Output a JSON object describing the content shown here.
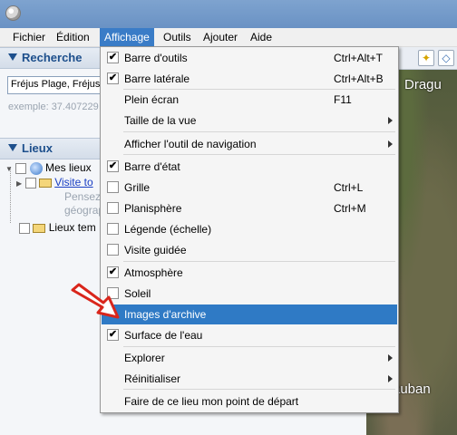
{
  "menubar": {
    "items": [
      {
        "label": "Fichier"
      },
      {
        "label": "Édition"
      },
      {
        "label": "Affichage"
      },
      {
        "label": "Outils"
      },
      {
        "label": "Ajouter"
      },
      {
        "label": "Aide"
      }
    ]
  },
  "search_panel": {
    "title": "Recherche",
    "input_value": "Fréjus Plage, Fréjus",
    "example": "exemple: 37.407229"
  },
  "places_panel": {
    "title": "Lieux",
    "items": [
      {
        "label": "Mes lieux"
      },
      {
        "label": "Visite to"
      },
      {
        "label": "Pensez"
      },
      {
        "label": "géograp"
      },
      {
        "label": "Lieux tem"
      }
    ]
  },
  "map": {
    "labels": [
      "Dragu",
      "auban"
    ]
  },
  "view_menu": {
    "items": [
      {
        "label": "Barre d'outils",
        "shortcut": "Ctrl+Alt+T",
        "checked": true
      },
      {
        "label": "Barre latérale",
        "shortcut": "Ctrl+Alt+B",
        "checked": true
      },
      {
        "label": "Plein écran",
        "shortcut": "F11"
      },
      {
        "label": "Taille de la vue",
        "submenu": true
      },
      {
        "label": "Afficher l'outil de navigation",
        "submenu": true
      },
      {
        "label": "Barre d'état",
        "checked": true
      },
      {
        "label": "Grille",
        "shortcut": "Ctrl+L",
        "checked": false
      },
      {
        "label": "Planisphère",
        "shortcut": "Ctrl+M",
        "checked": false
      },
      {
        "label": "Légende (échelle)",
        "checked": false
      },
      {
        "label": "Visite guidée",
        "checked": false
      },
      {
        "label": "Atmosphère",
        "checked": true
      },
      {
        "label": "Soleil",
        "checked": false
      },
      {
        "label": "Images d'archive",
        "checked": false,
        "highlighted": true
      },
      {
        "label": "Surface de l'eau",
        "checked": true
      },
      {
        "label": "Explorer",
        "submenu": true
      },
      {
        "label": "Réinitialiser",
        "submenu": true
      },
      {
        "label": "Faire de ce lieu mon point de départ"
      }
    ],
    "check_glyph": "✔"
  },
  "colors": {
    "accent": "#2f7ac5",
    "annotation_arrow": "#d9261c"
  }
}
